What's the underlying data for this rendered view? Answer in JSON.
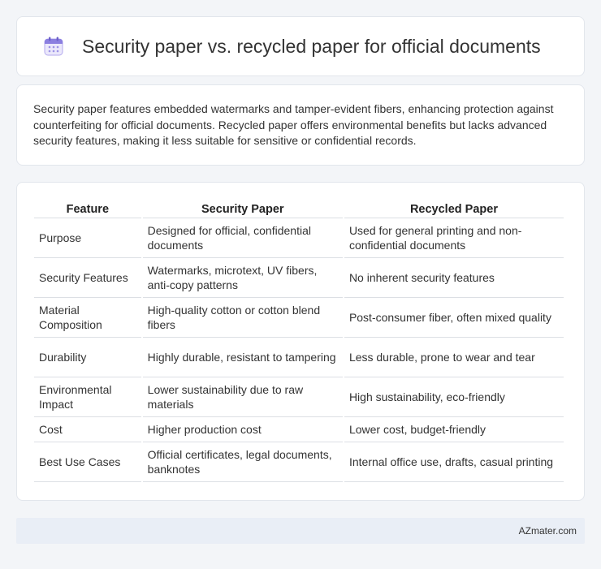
{
  "header": {
    "icon": "calendar-icon",
    "title": "Security paper vs. recycled paper for official documents"
  },
  "summary": {
    "text": "Security paper features embedded watermarks and tamper-evident fibers, enhancing protection against counterfeiting for official documents. Recycled paper offers environmental benefits but lacks advanced security features, making it less suitable for sensitive or confidential records."
  },
  "table": {
    "headers": [
      "Feature",
      "Security Paper",
      "Recycled Paper"
    ],
    "rows": [
      [
        "Purpose",
        "Designed for official, confidential documents",
        "Used for general printing and non-confidential documents"
      ],
      [
        "Security Features",
        "Watermarks, microtext, UV fibers, anti-copy patterns",
        "No inherent security features"
      ],
      [
        "Material Composition",
        "High-quality cotton or cotton blend fibers",
        "Post-consumer fiber, often mixed quality"
      ],
      [
        "Durability",
        "Highly durable, resistant to tampering",
        "Less durable, prone to wear and tear"
      ],
      [
        "Environmental Impact",
        "Lower sustainability due to raw materials",
        "High sustainability, eco-friendly"
      ],
      [
        "Cost",
        "Higher production cost",
        "Lower cost, budget-friendly"
      ],
      [
        "Best Use Cases",
        "Official certificates, legal documents, banknotes",
        "Internal office use, drafts, casual printing"
      ]
    ]
  },
  "footer": {
    "brand": "AZmater.com"
  },
  "colors": {
    "background": "#f3f5f8",
    "card": "#ffffff",
    "footer": "#e9eef6",
    "icon_accent": "#8b7fe0"
  }
}
